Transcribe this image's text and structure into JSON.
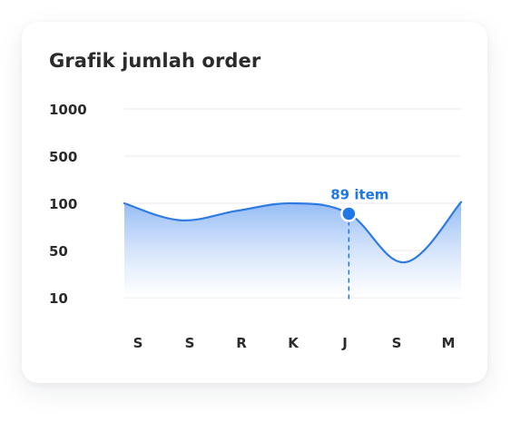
{
  "card": {
    "title": "Grafik jumlah order"
  },
  "chart_data": {
    "type": "area",
    "title": "Grafik jumlah order",
    "xlabel": "",
    "ylabel": "",
    "y_ticks": [
      "1000",
      "500",
      "100",
      "50",
      "10"
    ],
    "categories": [
      "S",
      "S",
      "R",
      "K",
      "J",
      "S",
      "M"
    ],
    "series": [
      {
        "values": [
          100,
          82,
          92,
          100,
          89,
          40,
          110
        ]
      }
    ],
    "grid": true,
    "highlight": {
      "index": 4,
      "label": "89 item"
    },
    "colors": {
      "line": "#2f7be4",
      "fill_top": "#8fb8f5",
      "fill_bottom": "#ffffff",
      "highlight": "#1f77e8",
      "label": "#1f77e8",
      "grid": "#e2e2e6",
      "axis_text": "#2b2b2b"
    }
  }
}
